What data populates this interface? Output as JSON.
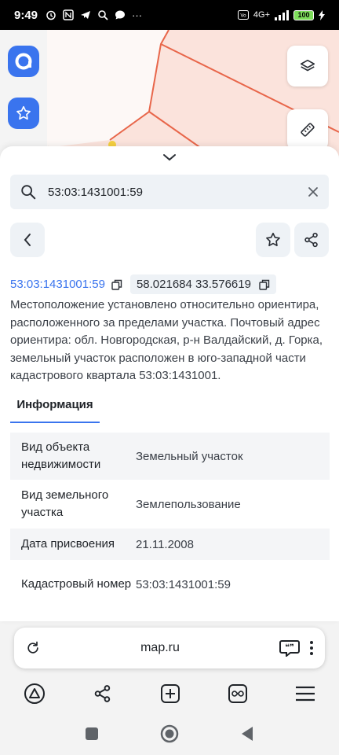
{
  "status": {
    "time": "9:49",
    "battery": "100",
    "network": "4G+"
  },
  "search": {
    "query": "53:03:1431001:59"
  },
  "parcel": {
    "cadastral_link": "53:03:1431001:59",
    "coordinates": "58.021684 33.576619",
    "description": "Местоположение установлено относительно ориентира, расположенного за пределами участка. Почтовый адрес ориентира: обл. Новгородская, р-н Валдайский, д. Горка, земельный участок расположен в юго-западной части кадастрового квартала 53:03:1431001."
  },
  "tabs": {
    "info": "Информация"
  },
  "info_rows": [
    {
      "label": "Вид объекта недвижимости",
      "value": "Земельный участок"
    },
    {
      "label": "Вид земельного участка",
      "value": "Землепользование"
    },
    {
      "label": "Дата присвоения",
      "value": "21.11.2008"
    },
    {
      "label": "Кадастровый номер",
      "value": "53:03:1431001:59"
    }
  ],
  "browser": {
    "url": "map.ru"
  },
  "icons": {
    "reload": "reload-icon",
    "chat": "chat-icon",
    "menu": "more-vertical-icon"
  },
  "colors": {
    "accent": "#3a74ee",
    "parcel_border": "#e8664a",
    "parcel_fill": "#fbe3dc"
  }
}
